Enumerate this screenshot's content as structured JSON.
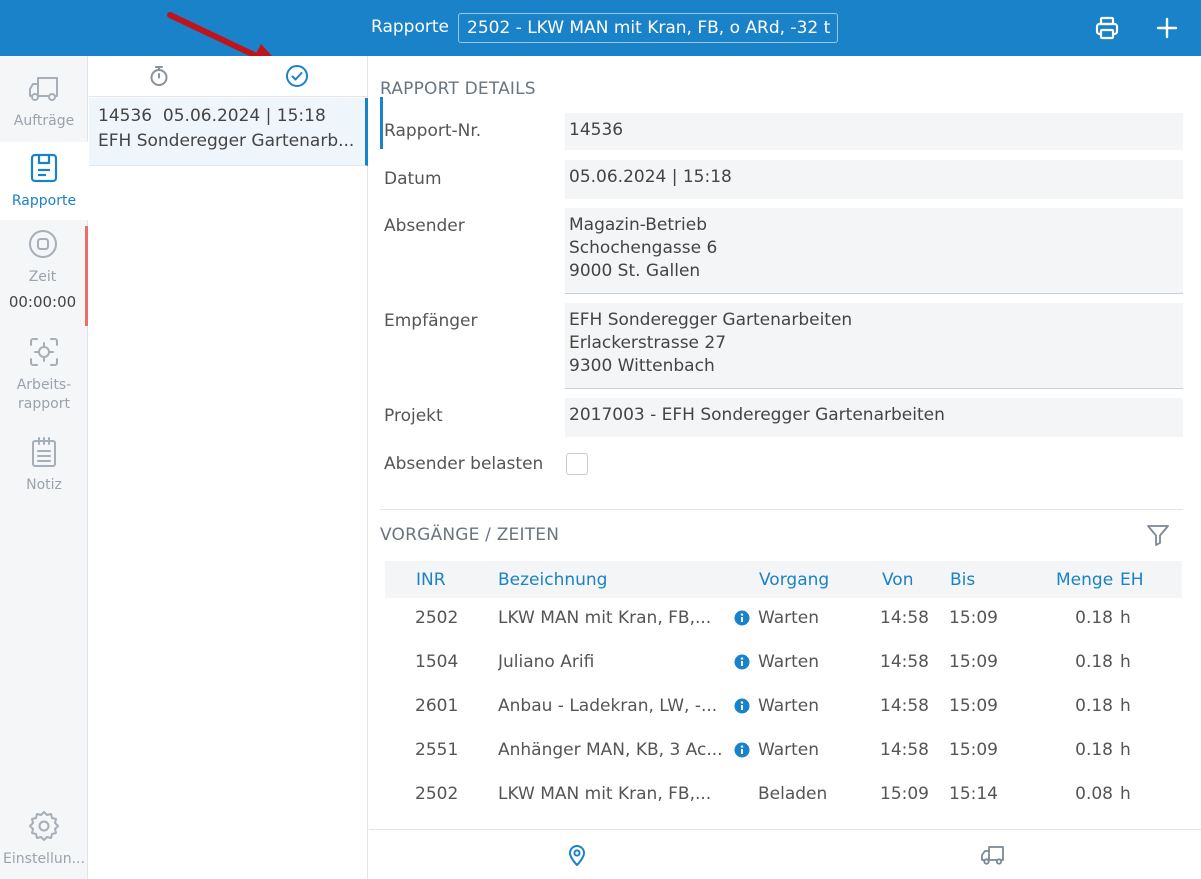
{
  "header": {
    "title": "Rapporte",
    "vehicle_select": "2502 - LKW MAN mit Kran, FB, o ARd, -32 t",
    "print_icon": "printer-icon",
    "add_icon": "plus-icon"
  },
  "colors": {
    "primary": "#1a82c8",
    "timer_indicator": "#ec6b6b",
    "annotation_arrow": "#c0141c"
  },
  "sidebar": {
    "items": [
      {
        "label": "Aufträge",
        "icon": "truck-icon"
      },
      {
        "label": "Rapporte",
        "icon": "report-icon",
        "active": true
      },
      {
        "label": "Zeit",
        "icon": "stop-circle-icon",
        "value": "00:00:00"
      },
      {
        "label": "Arbeits-",
        "label2": "rapport",
        "icon": "target-icon"
      },
      {
        "label": "Notiz",
        "icon": "notepad-icon"
      },
      {
        "label": "Einstellun...",
        "icon": "gear-icon"
      }
    ]
  },
  "list": {
    "tabs": [
      {
        "icon": "stopwatch-icon"
      },
      {
        "icon": "check-circle-icon",
        "active": true
      }
    ],
    "items": [
      {
        "nr": "14536",
        "datetime": "05.06.2024 | 15:18",
        "title": "EFH Sonderegger Gartenarb..."
      }
    ]
  },
  "details": {
    "section_title": "RAPPORT DETAILS",
    "rapport_nr": {
      "label": "Rapport-Nr.",
      "value": "14536"
    },
    "datum": {
      "label": "Datum",
      "value": "05.06.2024 | 15:18"
    },
    "absender": {
      "label": "Absender",
      "lines": [
        "Magazin-Betrieb",
        "Schochengasse 6",
        "9000 St. Gallen"
      ]
    },
    "empfaenger": {
      "label": "Empfänger",
      "lines": [
        "EFH Sonderegger Gartenarbeiten",
        "Erlackerstrasse 27",
        "9300 Wittenbach"
      ]
    },
    "projekt": {
      "label": "Projekt",
      "value": "2017003 - EFH Sonderegger Gartenarbeiten"
    },
    "absender_belasten": {
      "label": "Absender belasten",
      "checked": false
    }
  },
  "vorgaenge": {
    "section_title": "VORGÄNGE / ZEITEN",
    "filter_icon": "filter-icon",
    "columns": [
      "INR",
      "Bezeichnung",
      "Vorgang",
      "Von",
      "Bis",
      "Menge",
      "EH"
    ],
    "rows": [
      {
        "inr": "2502",
        "bez": "LKW MAN mit Kran, FB,...",
        "info": true,
        "vorgang": "Warten",
        "von": "14:58",
        "bis": "15:09",
        "menge": "0.18",
        "eh": "h"
      },
      {
        "inr": "1504",
        "bez": "Juliano Arifi",
        "info": true,
        "vorgang": "Warten",
        "von": "14:58",
        "bis": "15:09",
        "menge": "0.18",
        "eh": "h"
      },
      {
        "inr": "2601",
        "bez": "Anbau - Ladekran, LW, -...",
        "info": true,
        "vorgang": "Warten",
        "von": "14:58",
        "bis": "15:09",
        "menge": "0.18",
        "eh": "h"
      },
      {
        "inr": "2551",
        "bez": "Anhänger MAN, KB, 3 Ac...",
        "info": true,
        "vorgang": "Warten",
        "von": "14:58",
        "bis": "15:09",
        "menge": "0.18",
        "eh": "h"
      },
      {
        "inr": "2502",
        "bez": "LKW MAN mit Kran, FB,...",
        "info": false,
        "vorgang": "Beladen",
        "von": "15:09",
        "bis": "15:14",
        "menge": "0.08",
        "eh": "h"
      }
    ]
  },
  "bottombar": {
    "icons": [
      "location-pin-icon",
      "truck-icon"
    ]
  }
}
